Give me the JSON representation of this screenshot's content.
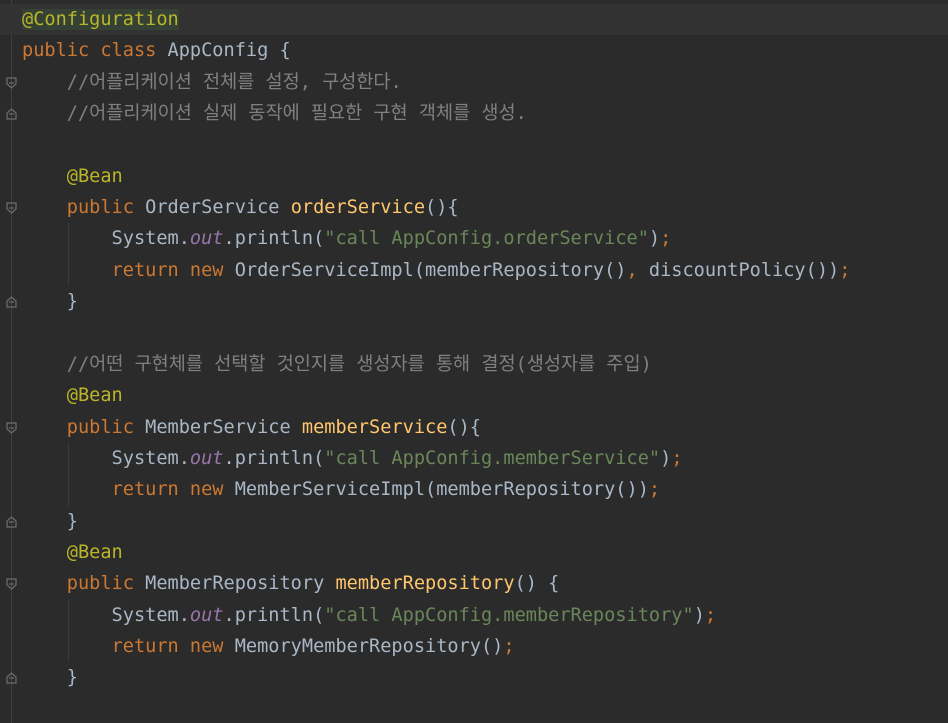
{
  "editor": {
    "language": "java",
    "lines": [
      {
        "tokens": [
          {
            "t": "@Configuration",
            "c": "ann ann-hl"
          }
        ]
      },
      {
        "tokens": [
          {
            "t": "public class ",
            "c": "kw"
          },
          {
            "t": "AppConfig {",
            "c": ""
          }
        ]
      },
      {
        "tokens": [
          {
            "t": "    //어플리케이션 전체를 설정, 구성한다.",
            "c": "cm"
          }
        ]
      },
      {
        "tokens": [
          {
            "t": "    //어플리케이션 실제 동작에 필요한 구현 객체를 생성.",
            "c": "cm"
          }
        ]
      },
      {
        "tokens": []
      },
      {
        "tokens": [
          {
            "t": "    ",
            "c": ""
          },
          {
            "t": "@Bean",
            "c": "ann"
          }
        ]
      },
      {
        "tokens": [
          {
            "t": "    ",
            "c": ""
          },
          {
            "t": "public ",
            "c": "kw"
          },
          {
            "t": "OrderService ",
            "c": ""
          },
          {
            "t": "orderService",
            "c": "fn"
          },
          {
            "t": "(){",
            "c": ""
          }
        ]
      },
      {
        "tokens": [
          {
            "t": "        System.",
            "c": ""
          },
          {
            "t": "out",
            "c": "fld"
          },
          {
            "t": ".println(",
            "c": ""
          },
          {
            "t": "\"call AppConfig.orderService\"",
            "c": "st"
          },
          {
            "t": ")",
            "c": ""
          },
          {
            "t": ";",
            "c": "kw"
          }
        ]
      },
      {
        "tokens": [
          {
            "t": "        ",
            "c": ""
          },
          {
            "t": "return new ",
            "c": "kw"
          },
          {
            "t": "OrderServiceImpl(memberRepository()",
            "c": ""
          },
          {
            "t": ", ",
            "c": "kw"
          },
          {
            "t": "discountPolicy())",
            "c": ""
          },
          {
            "t": ";",
            "c": "kw"
          }
        ]
      },
      {
        "tokens": [
          {
            "t": "    }",
            "c": ""
          }
        ]
      },
      {
        "tokens": []
      },
      {
        "tokens": [
          {
            "t": "    //어떤 구현체를 선택할 것인지를 생성자를 통해 결정(생성자를 주입)",
            "c": "cm"
          }
        ]
      },
      {
        "tokens": [
          {
            "t": "    ",
            "c": ""
          },
          {
            "t": "@Bean",
            "c": "ann"
          }
        ]
      },
      {
        "tokens": [
          {
            "t": "    ",
            "c": ""
          },
          {
            "t": "public ",
            "c": "kw"
          },
          {
            "t": "MemberService ",
            "c": ""
          },
          {
            "t": "memberService",
            "c": "fn"
          },
          {
            "t": "(){",
            "c": ""
          }
        ]
      },
      {
        "tokens": [
          {
            "t": "        System.",
            "c": ""
          },
          {
            "t": "out",
            "c": "fld"
          },
          {
            "t": ".println(",
            "c": ""
          },
          {
            "t": "\"call AppConfig.memberService\"",
            "c": "st"
          },
          {
            "t": ")",
            "c": ""
          },
          {
            "t": ";",
            "c": "kw"
          }
        ]
      },
      {
        "tokens": [
          {
            "t": "        ",
            "c": ""
          },
          {
            "t": "return new ",
            "c": "kw"
          },
          {
            "t": "MemberServiceImpl(memberRepository())",
            "c": ""
          },
          {
            "t": ";",
            "c": "kw"
          }
        ]
      },
      {
        "tokens": [
          {
            "t": "    }",
            "c": ""
          }
        ]
      },
      {
        "tokens": [
          {
            "t": "    ",
            "c": ""
          },
          {
            "t": "@Bean",
            "c": "ann"
          }
        ]
      },
      {
        "tokens": [
          {
            "t": "    ",
            "c": ""
          },
          {
            "t": "public ",
            "c": "kw"
          },
          {
            "t": "MemberRepository ",
            "c": ""
          },
          {
            "t": "memberRepository",
            "c": "fn"
          },
          {
            "t": "() {",
            "c": ""
          }
        ]
      },
      {
        "tokens": [
          {
            "t": "        System.",
            "c": ""
          },
          {
            "t": "out",
            "c": "fld"
          },
          {
            "t": ".println(",
            "c": ""
          },
          {
            "t": "\"call AppConfig.memberRepository\"",
            "c": "st"
          },
          {
            "t": ")",
            "c": ""
          },
          {
            "t": ";",
            "c": "kw"
          }
        ]
      },
      {
        "tokens": [
          {
            "t": "        ",
            "c": ""
          },
          {
            "t": "return new ",
            "c": "kw"
          },
          {
            "t": "MemoryMemberRepository()",
            "c": ""
          },
          {
            "t": ";",
            "c": "kw"
          }
        ]
      },
      {
        "tokens": [
          {
            "t": "    }",
            "c": ""
          }
        ]
      }
    ],
    "colors": {
      "background": "#2b2b2b",
      "keyword": "#cc7832",
      "annotation": "#bbb529",
      "comment": "#808080",
      "method_declaration": "#ffc66d",
      "string": "#6a8759",
      "static_field": "#9876aa",
      "default_text": "#a9b7c6"
    }
  }
}
